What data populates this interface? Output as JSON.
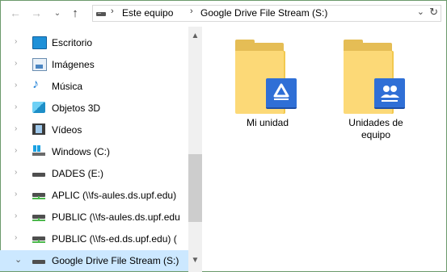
{
  "address_bar": {
    "breadcrumbs": [
      "Este equipo",
      "Google Drive File Stream (S:)"
    ]
  },
  "nav_pane": {
    "items": [
      {
        "label": "Escritorio",
        "icon": "desktop-icon"
      },
      {
        "label": "Imágenes",
        "icon": "pictures-icon"
      },
      {
        "label": "Música",
        "icon": "music-icon"
      },
      {
        "label": "Objetos 3D",
        "icon": "3d-objects-icon"
      },
      {
        "label": "Vídeos",
        "icon": "videos-icon"
      },
      {
        "label": "Windows (C:)",
        "icon": "windows-drive-icon"
      },
      {
        "label": "DADES (E:)",
        "icon": "drive-icon"
      },
      {
        "label": "APLIC (\\\\fs-aules.ds.upf.edu)",
        "icon": "network-drive-icon"
      },
      {
        "label": "PUBLIC (\\\\fs-aules.ds.upf.edu",
        "icon": "network-drive-icon"
      },
      {
        "label": "PUBLIC (\\\\fs-ed.ds.upf.edu) (",
        "icon": "network-drive-icon"
      },
      {
        "label": "Google Drive File Stream (S:)",
        "icon": "drive-icon",
        "selected": true
      }
    ]
  },
  "content": {
    "items": [
      {
        "label": "Mi unidad",
        "icon": "google-drive-folder-icon"
      },
      {
        "label": "Unidades de equipo",
        "icon": "team-drive-folder-icon"
      }
    ]
  },
  "colors": {
    "selection": "#cce8ff",
    "folder": "#fcd977",
    "badge": "#2f6fd6"
  }
}
